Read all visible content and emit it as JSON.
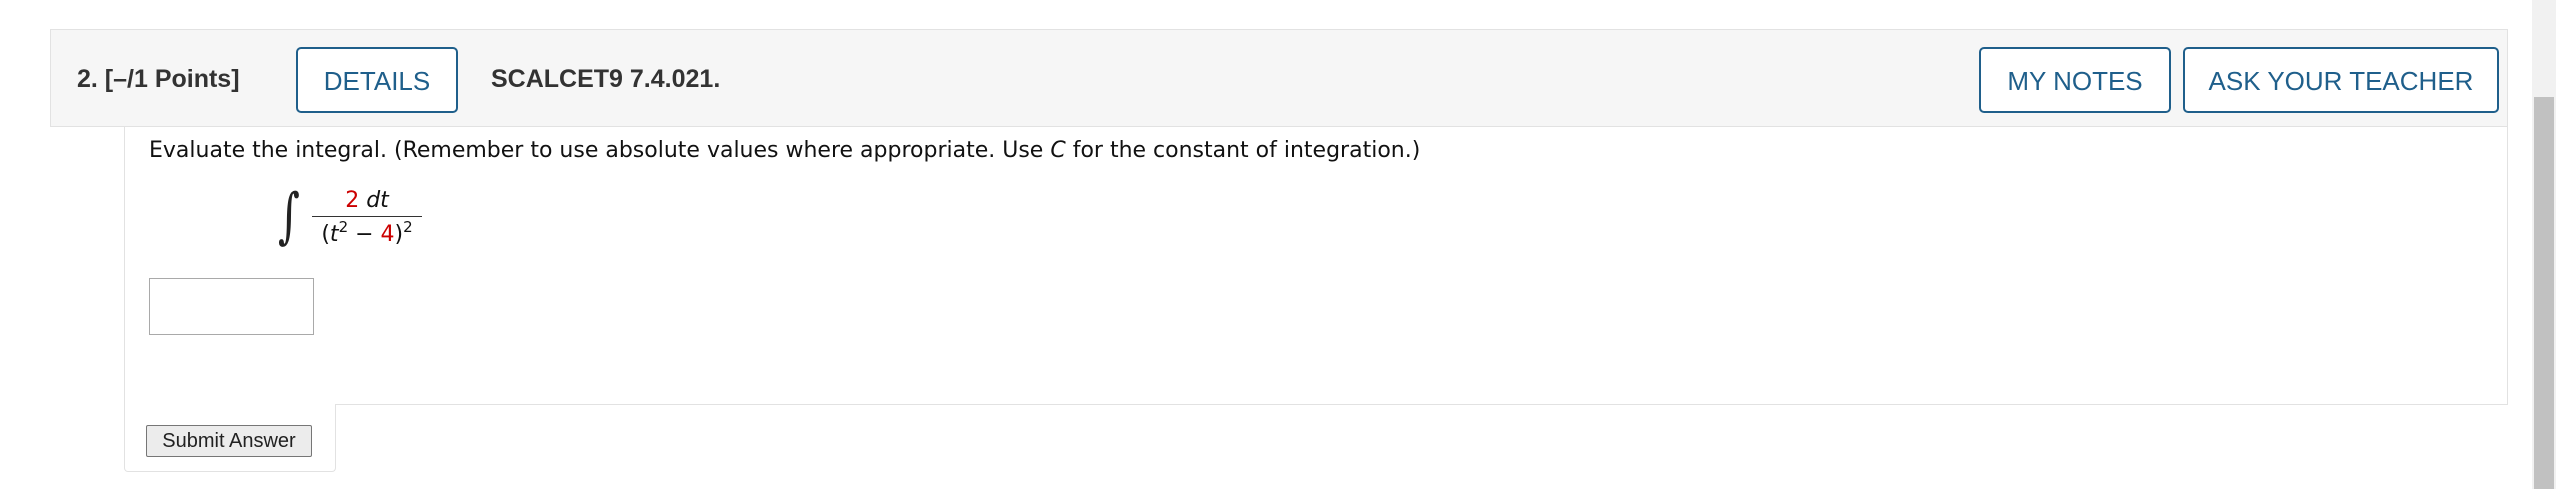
{
  "question": {
    "number_points": "2.  [–/1 Points]",
    "details_label": "DETAILS",
    "code": "SCALCET9 7.4.021.",
    "my_notes_label": "MY NOTES",
    "ask_teacher_label": "ASK YOUR TEACHER"
  },
  "body": {
    "instructions_before": "Evaluate the integral. (Remember to use absolute values where appropriate. Use ",
    "instructions_var": "C",
    "instructions_after": " for the constant of integration.)",
    "integral_sign": "∫",
    "numerator_coef": "2",
    "numerator_diff": "dt",
    "denom_open": "(",
    "denom_var": "t",
    "denom_inner_exp": "2",
    "denom_minus": " − ",
    "denom_const": "4",
    "denom_close": ")",
    "denom_outer_exp": "2",
    "answer_value": "",
    "submit_label": "Submit Answer"
  },
  "colors": {
    "accent": "#1f5f8b",
    "highlight": "#cc0000",
    "header_bg": "#f6f6f6"
  }
}
